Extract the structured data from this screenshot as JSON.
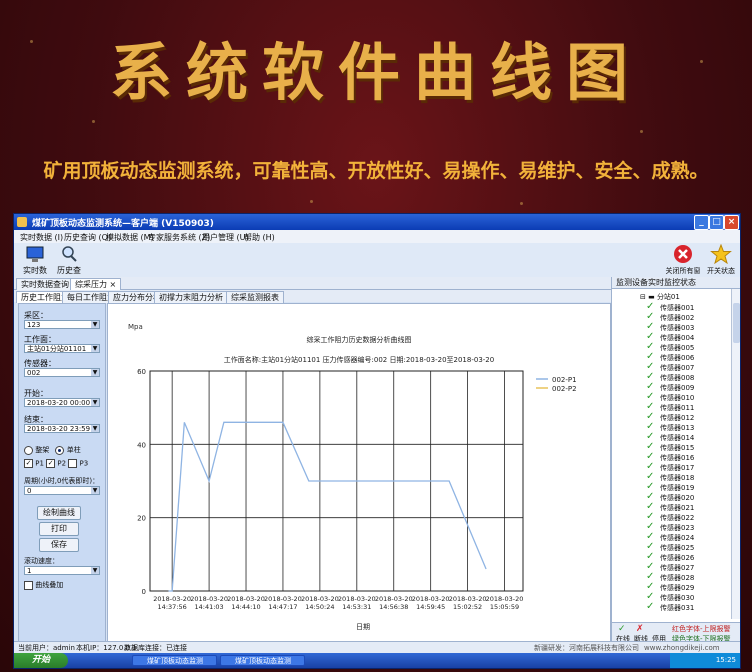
{
  "banner": {
    "title": "系统软件曲线图",
    "subtitle": "矿用顶板动态监测系统，可靠性高、开放性好、易操作、易维护、安全、成熟。"
  },
  "window": {
    "title": "煤矿顶板动态监测系统—客户端 (V150903)",
    "menu": [
      "实时数据 (I)",
      "历史查询 (Q)",
      "模拟数据 (M)",
      "专家服务系统 (Z)",
      "用户管理 (U)",
      "帮助 (H)"
    ],
    "toolbar": {
      "realtime_label": "实时数据",
      "history_label": "历史查询",
      "close_all_label": "关闭所有窗口",
      "status_label": "开关状态"
    },
    "tabs": [
      "实时数据查询",
      "综采压力"
    ],
    "subtabs": [
      "历史工作阻力",
      "每日工作阻力",
      "应力分布分析",
      "初撑力末阻力分析",
      "综采监测报表"
    ]
  },
  "left_panel": {
    "area_label": "采区：",
    "area_value": "123",
    "face_label": "工作面：",
    "face_value": "主站01分站01101",
    "sensor_label": "传感器：",
    "sensor_value": "002",
    "start_label": "开始：",
    "start_value": "2018-03-20 00:00",
    "end_label": "结束：",
    "end_value": "2018-03-20 23:59",
    "radio_whole": "整架",
    "radio_single": "单柱",
    "check_p1": "P1",
    "check_p2": "P2",
    "check_p3": "P3",
    "period_label": "周期(小时,0代表即时)：",
    "period_value": "0",
    "draw_button": "绘制曲线",
    "print_button": "打印",
    "save_button": "保存",
    "scroll_speed_label": "滚动速度：",
    "scroll_speed_value": "1",
    "overlay_label": "曲线叠加"
  },
  "chart_data": {
    "type": "line",
    "title": "综采工作阻力历史数据分析曲线图",
    "subtitle": "工作面名称:主站01分站01101   压力传感器编号:002   日期:2018-03-20至2018-03-20",
    "ylabel": "Mpa",
    "xlabel": "日期",
    "ylim": [
      0,
      60
    ],
    "yticks": [
      0,
      20,
      40,
      60
    ],
    "x": [
      "2018-03-20 14:37:56",
      "2018-03-20 14:41:03",
      "2018-03-20 14:44:10",
      "2018-03-20 14:47:17",
      "2018-03-20 14:50:24",
      "2018-03-20 14:53:31",
      "2018-03-20 14:56:38",
      "2018-03-20 14:59:45",
      "2018-03-20 15:02:52",
      "2018-03-20 15:05:59"
    ],
    "series": [
      {
        "name": "002-P1",
        "color": "#8fb4e3",
        "points": [
          [
            -0.1,
            0
          ],
          [
            0,
            0
          ],
          [
            0.33,
            46
          ],
          [
            1.0,
            30
          ],
          [
            1.4,
            46
          ],
          [
            3.0,
            46
          ],
          [
            3.7,
            30
          ],
          [
            5.0,
            30
          ],
          [
            7.5,
            30
          ],
          [
            8.5,
            6
          ]
        ]
      },
      {
        "name": "002-P2",
        "color": "#e8c25a",
        "points": []
      }
    ],
    "grid": true,
    "legend": "right"
  },
  "right_panel": {
    "header": "监测设备实时监控状态",
    "station": "分站01",
    "sensors": [
      "传感器001",
      "传感器002",
      "传感器003",
      "传感器004",
      "传感器005",
      "传感器006",
      "传感器007",
      "传感器008",
      "传感器009",
      "传感器010",
      "传感器011",
      "传感器012",
      "传感器013",
      "传感器014",
      "传感器015",
      "传感器016",
      "传感器017",
      "传感器018",
      "传感器019",
      "传感器020",
      "传感器021",
      "传感器022",
      "传感器023",
      "传感器024",
      "传感器025",
      "传感器026",
      "传感器027",
      "传感器028",
      "传感器029",
      "传感器030",
      "传感器031"
    ],
    "legend_online": "在线",
    "legend_offline": "断线",
    "legend_disabled": "停用",
    "legend_red": "红色字体-上限报警",
    "legend_green": "绿色字体-下限报警"
  },
  "status_bar": {
    "user": "当前用户：admin",
    "ip": "本机IP：127.0.0.1",
    "db": "数据库连接：已连接",
    "company": "新疆研发：河南拓展科技有限公司",
    "website": "www.zhongdikeji.com"
  },
  "taskbar": {
    "start": "开始",
    "task1": "煤矿顶板动态监测",
    "task2": "煤矿顶板动态监测",
    "clock": "15:25"
  }
}
